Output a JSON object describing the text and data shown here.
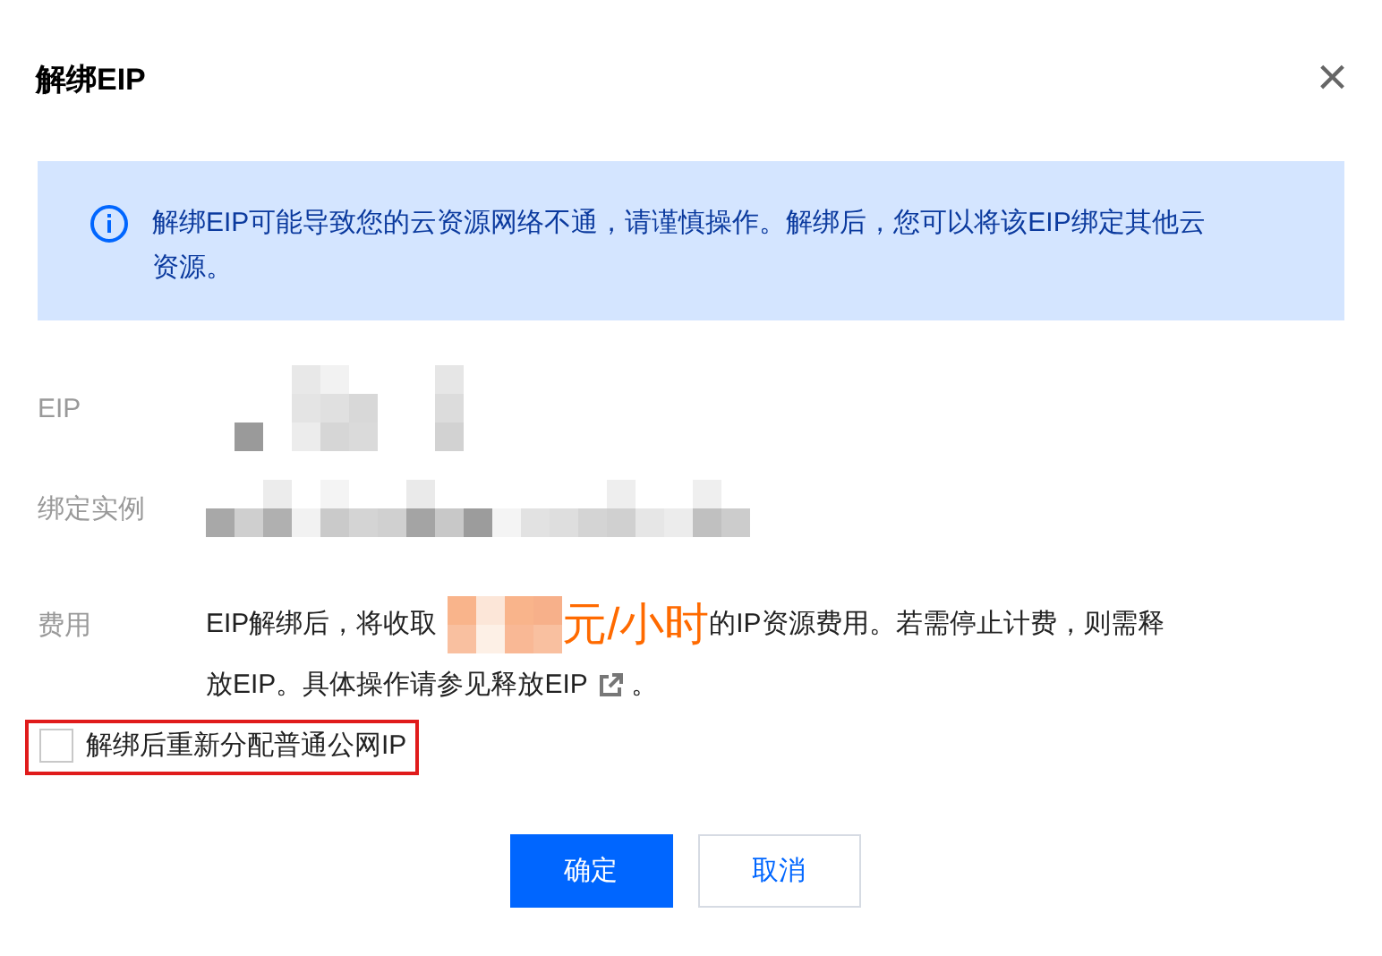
{
  "dialog": {
    "title": "解绑EIP",
    "close": "×"
  },
  "alert": {
    "message": "解绑EIP可能导致您的云资源网络不通，请谨慎操作。解绑后，您可以将该EIP绑定其他云资源。"
  },
  "fields": [
    {
      "label": "EIP"
    },
    {
      "label": "绑定实例"
    }
  ],
  "fee": {
    "label": "费用",
    "prefix": "EIP解绑后，将收取",
    "unit": "元/小时",
    "suffix": "的IP资源费用。若需停止计费，则需释",
    "line2": "放EIP。具体操作请参见",
    "link": "释放EIP",
    "end": "。"
  },
  "option": {
    "label": "解绑后重新分配普通公网IP",
    "checked": false,
    "highlighted": true
  },
  "buttons": [
    {
      "label": "确定",
      "kind": "primary"
    },
    {
      "label": "取消",
      "kind": "secondary"
    }
  ]
}
